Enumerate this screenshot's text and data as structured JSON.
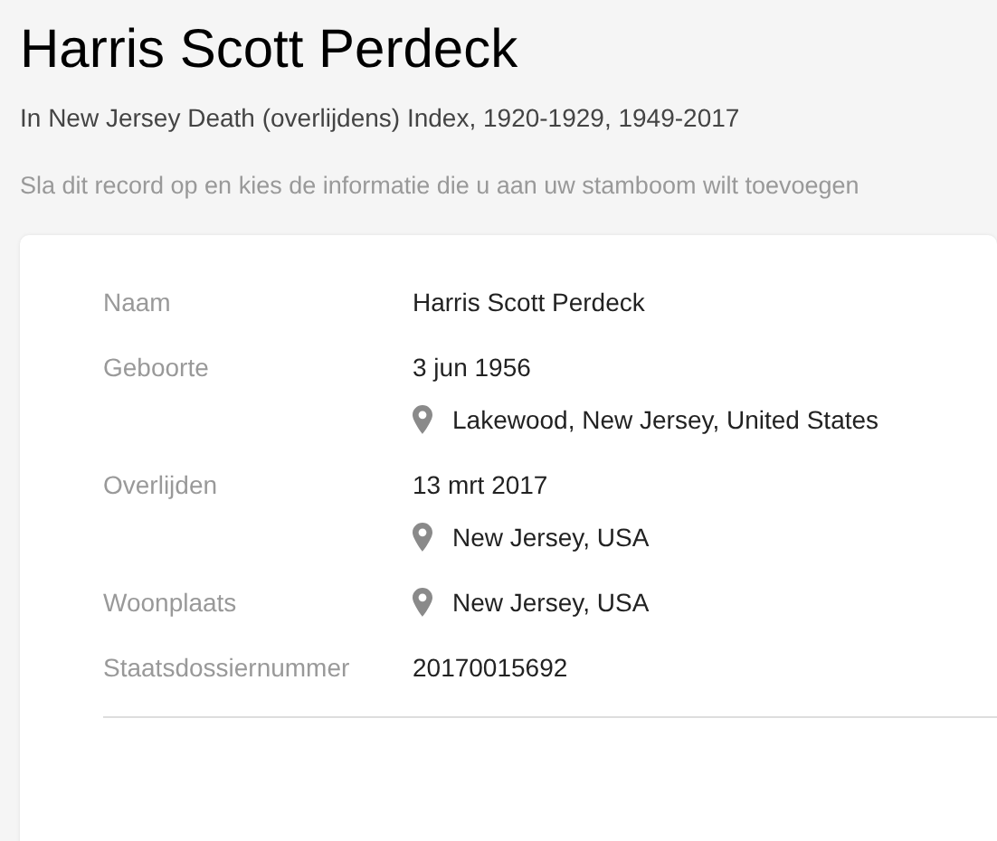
{
  "title": "Harris Scott Perdeck",
  "subtitle": "In New Jersey Death (overlijdens) Index, 1920-1929, 1949-2017",
  "hint": "Sla dit record op en kies de informatie die u aan uw stamboom wilt toevoegen",
  "facts": [
    {
      "label": "Naam",
      "values": [
        {
          "kind": "text",
          "text": "Harris Scott Perdeck"
        }
      ]
    },
    {
      "label": "Geboorte",
      "values": [
        {
          "kind": "text",
          "text": "3 jun 1956"
        },
        {
          "kind": "place",
          "text": "Lakewood, New Jersey, United States"
        }
      ]
    },
    {
      "label": "Overlijden",
      "values": [
        {
          "kind": "text",
          "text": "13 mrt 2017"
        },
        {
          "kind": "place",
          "text": "New Jersey, USA"
        }
      ]
    },
    {
      "label": "Woonplaats",
      "values": [
        {
          "kind": "place",
          "text": "New Jersey, USA"
        }
      ]
    },
    {
      "label": "Staatsdossiernummer",
      "values": [
        {
          "kind": "text",
          "text": "20170015692"
        }
      ]
    }
  ]
}
